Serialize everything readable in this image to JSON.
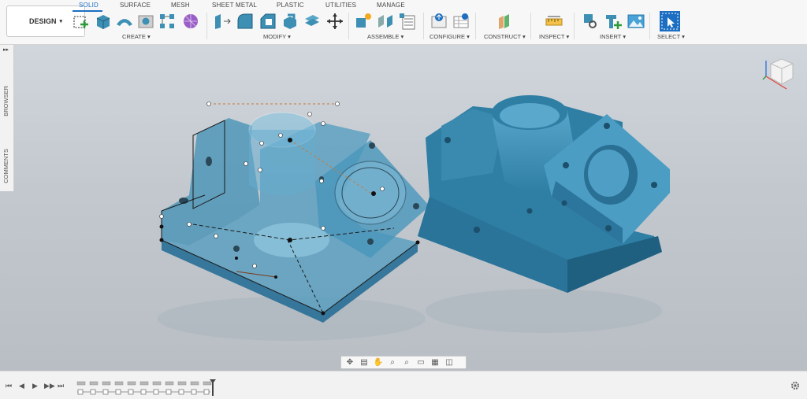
{
  "workspace": {
    "label": "DESIGN",
    "arrow": "▾"
  },
  "tabs": [
    {
      "label": "SOLID",
      "active": true
    },
    {
      "label": "SURFACE",
      "active": false
    },
    {
      "label": "MESH",
      "active": false
    },
    {
      "label": "SHEET METAL",
      "active": false
    },
    {
      "label": "PLASTIC",
      "active": false
    },
    {
      "label": "UTILITIES",
      "active": false
    },
    {
      "label": "MANAGE",
      "active": false
    }
  ],
  "groups": {
    "create": "CREATE ▾",
    "modify": "MODIFY ▾",
    "assemble": "ASSEMBLE ▾",
    "configure": "CONFIGURE ▾",
    "construct": "CONSTRUCT ▾",
    "inspect": "INSPECT ▾",
    "insert": "INSERT ▾",
    "select": "SELECT ▾"
  },
  "side_panel": {
    "browser": "BROWSER",
    "comments": "COMMENTS",
    "expand": "▸▸"
  },
  "colors": {
    "accent": "#1b6ec2",
    "model": "#3d8fb4",
    "model_dark": "#24698c"
  },
  "timeline": {
    "buttons": [
      "⏮",
      "◀",
      "▶",
      "▶▶",
      "⏭"
    ]
  }
}
